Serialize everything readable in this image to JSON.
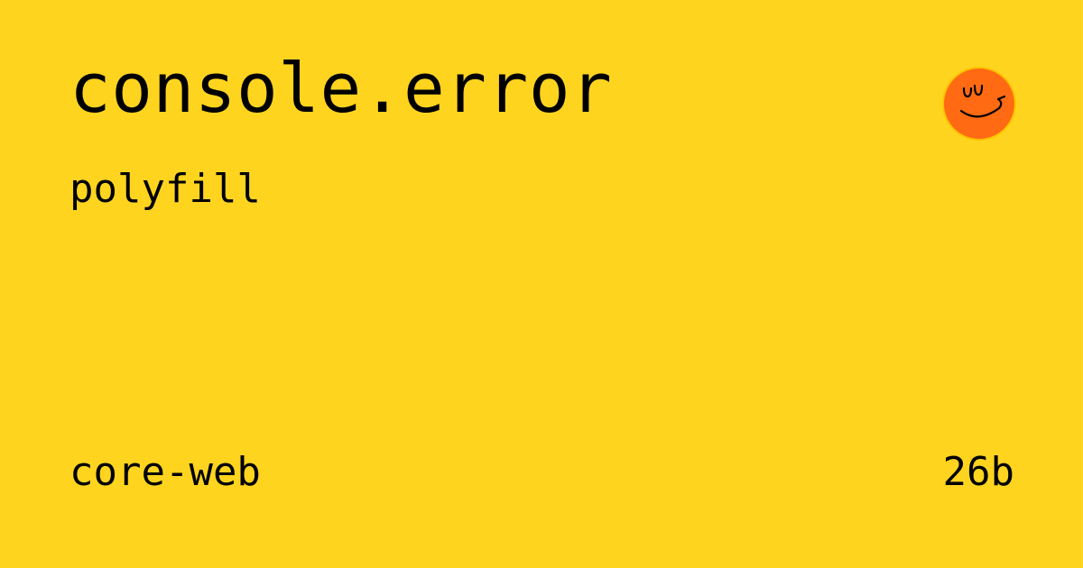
{
  "card": {
    "title": "console.error",
    "subtitle": "polyfill",
    "package": "core-web",
    "size": "26b"
  },
  "logo": {
    "icon": "smiley-face-icon",
    "color": "#FF6A13"
  },
  "colors": {
    "background": "#FFD41F",
    "text": "#000000"
  }
}
